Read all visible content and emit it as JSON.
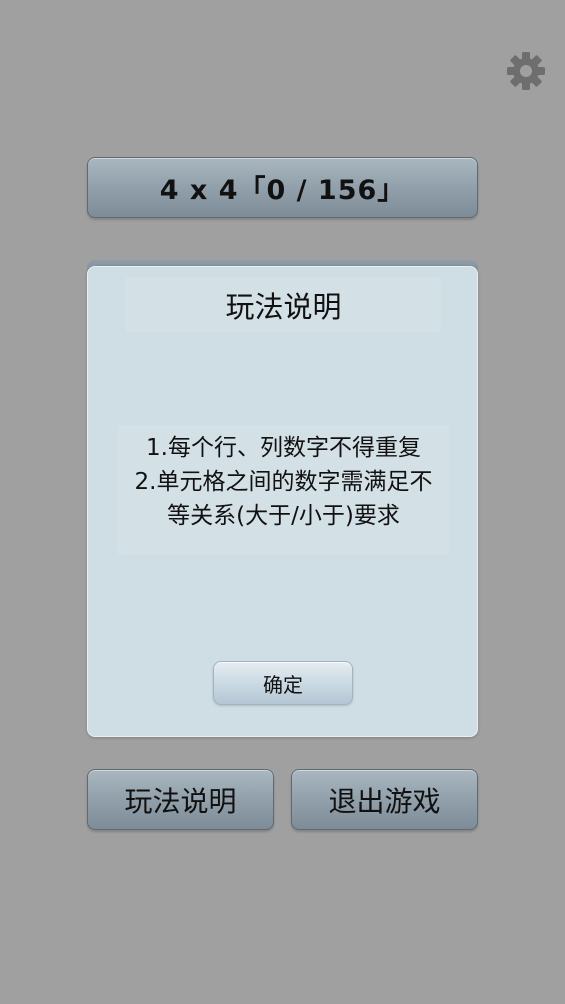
{
  "settings": {
    "icon": "gear-icon",
    "color": "#6e6e6e"
  },
  "level": {
    "label": "4 x 4「0 / 156」"
  },
  "dialog": {
    "title": "玩法说明",
    "lines": [
      "1.每个行、列数字不得重复",
      "2.单元格之间的数字需满足不",
      "等关系(大于/小于)要求"
    ],
    "confirm_label": "确定"
  },
  "bottom": {
    "how_to_play_label": "玩法说明",
    "quit_label": "退出游戏"
  },
  "colors": {
    "background": "#a0a0a0",
    "dialog": "#cfdde4",
    "button": "#93a2ac"
  }
}
